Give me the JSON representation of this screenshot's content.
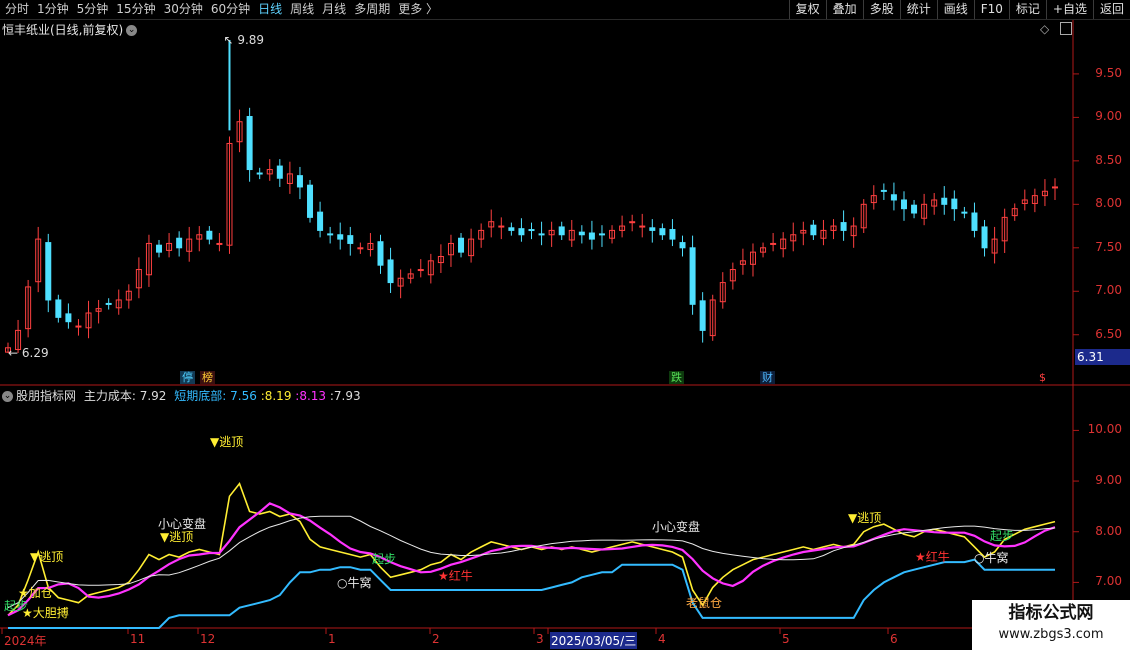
{
  "tabs": [
    {
      "label": "分时",
      "active": false
    },
    {
      "label": "1分钟",
      "active": false
    },
    {
      "label": "5分钟",
      "active": false
    },
    {
      "label": "15分钟",
      "active": false
    },
    {
      "label": "30分钟",
      "active": false
    },
    {
      "label": "60分钟",
      "active": false
    },
    {
      "label": "日线",
      "active": true
    },
    {
      "label": "周线",
      "active": false
    },
    {
      "label": "月线",
      "active": false
    },
    {
      "label": "多周期",
      "active": false
    },
    {
      "label": "更多 〉",
      "active": false
    }
  ],
  "tools": [
    "复权",
    "叠加",
    "多股",
    "统计",
    "画线",
    "F10",
    "标记",
    "+自选",
    "返回"
  ],
  "main": {
    "title": "恒丰纸业(日线,前复权)",
    "high_label": "9.89",
    "low_label": "6.29",
    "price_tag": "6.31",
    "y_ticks": [
      "9.50",
      "9.00",
      "8.50",
      "8.00",
      "7.50",
      "7.00",
      "6.50"
    ],
    "markers": [
      {
        "text": "停",
        "color": "#4fd0ff",
        "bg": "#123a55"
      },
      {
        "text": "榜",
        "color": "#ffcc33",
        "bg": "#3a1010"
      },
      {
        "text": "跌",
        "color": "#55dd55",
        "bg": "#0d3a0d"
      },
      {
        "text": "财",
        "color": "#4fb8ff",
        "bg": "#0d1f3a"
      },
      {
        "text": "$",
        "color": "#ff4040",
        "bg": "#000"
      }
    ]
  },
  "indicator": {
    "name": "股朋指标网",
    "series_label": "主力成本:",
    "val_main": "7.92",
    "short_label": "短期底部:",
    "val_short": "7.56",
    "val_yellow": "8.19",
    "val_magenta": "8.13",
    "val_white": "7.93",
    "y_ticks": [
      "10.00",
      "9.00",
      "8.00",
      "7.00"
    ],
    "annotations": [
      "逃顶",
      "逃顶",
      "逃顶",
      "逃顶",
      "加仓",
      "大胆搏",
      "起步",
      "小心变盘",
      "小心变盘",
      "牛窝",
      "牛窝",
      "红牛",
      "红牛",
      "老鼠仓",
      "起步",
      "起步"
    ]
  },
  "dates": [
    "2024年",
    "11",
    "12",
    "1",
    "2",
    "3",
    "2025/03/05/三",
    "4",
    "5",
    "6"
  ],
  "watermark": {
    "title": "指标公式网",
    "url": "www.zbgs3.com"
  },
  "colors": {
    "up": "#ff4040",
    "down": "#4fe0ff",
    "yellow": "#ffee33",
    "magenta": "#ff33ff",
    "cyan": "#33bbff",
    "white": "#e8e8e8",
    "axis": "#cc2020"
  },
  "chart_data": {
    "type": "candlestick",
    "title": "恒丰纸业(日线,前复权)",
    "ylim": [
      6.29,
      9.89
    ],
    "y_ticks": [
      6.5,
      7.0,
      7.5,
      8.0,
      8.5,
      9.0,
      9.5
    ],
    "x_labels": [
      "2024年",
      "11",
      "12",
      "1",
      "2",
      "3",
      "2025/03/05/三",
      "4",
      "5",
      "6"
    ],
    "close": [
      6.35,
      6.55,
      7.05,
      7.6,
      6.9,
      6.7,
      6.65,
      6.6,
      6.75,
      6.8,
      6.85,
      6.9,
      7.0,
      7.25,
      7.55,
      7.45,
      7.55,
      7.5,
      7.6,
      7.65,
      7.6,
      7.55,
      8.7,
      8.95,
      8.4,
      8.35,
      8.4,
      8.3,
      8.35,
      8.2,
      7.85,
      7.7,
      7.65,
      7.6,
      7.55,
      7.5,
      7.55,
      7.3,
      7.1,
      7.15,
      7.2,
      7.25,
      7.35,
      7.4,
      7.55,
      7.45,
      7.6,
      7.7,
      7.8,
      7.75,
      7.7,
      7.65,
      7.7,
      7.65,
      7.7,
      7.65,
      7.7,
      7.65,
      7.6,
      7.65,
      7.7,
      7.75,
      7.8,
      7.75,
      7.7,
      7.65,
      7.6,
      7.5,
      6.85,
      6.55,
      6.9,
      7.1,
      7.25,
      7.35,
      7.45,
      7.5,
      7.55,
      7.6,
      7.65,
      7.7,
      7.65,
      7.7,
      7.75,
      7.7,
      7.75,
      8.0,
      8.1,
      8.15,
      8.05,
      7.95,
      7.9,
      8.0,
      8.05,
      8.0,
      7.95,
      7.9,
      7.7,
      7.5,
      7.6,
      7.85,
      7.95,
      8.05,
      8.1,
      8.15,
      8.2
    ]
  }
}
